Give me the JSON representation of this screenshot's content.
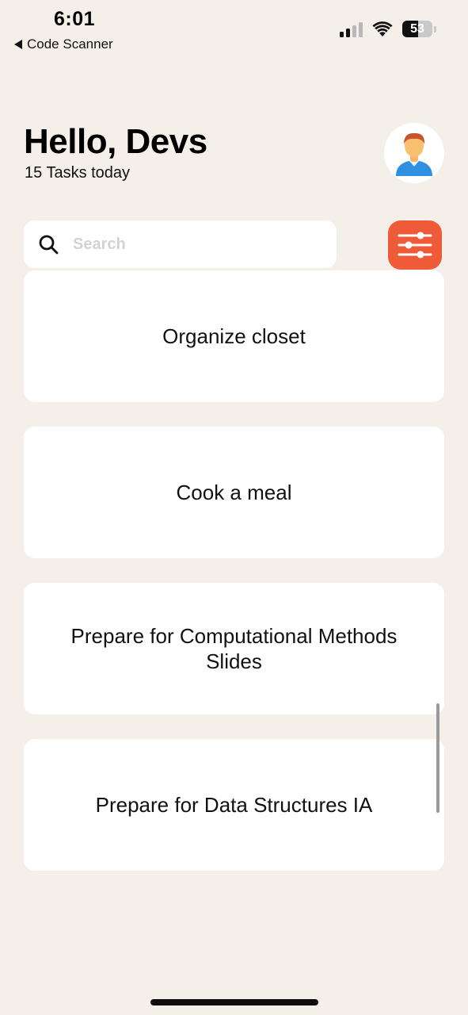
{
  "status_bar": {
    "time": "6:01",
    "back_label": "Code Scanner",
    "battery_level": "53",
    "battery_fraction": 0.53
  },
  "header": {
    "greeting": "Hello, Devs",
    "subtitle": "15 Tasks today",
    "avatar_icon": "person-avatar-icon"
  },
  "search": {
    "placeholder": "Search",
    "value": "",
    "icon": "search-icon"
  },
  "filter_button": {
    "icon": "sliders-icon",
    "color": "#ef5a38"
  },
  "tasks": [
    {
      "title": "Organize closet"
    },
    {
      "title": "Cook a meal"
    },
    {
      "title": "Prepare for Computational Methods Slides"
    },
    {
      "title": "Prepare for Data Structures IA"
    }
  ],
  "colors": {
    "background": "#f5efe9",
    "card": "#ffffff",
    "accent": "#ef5a38"
  }
}
